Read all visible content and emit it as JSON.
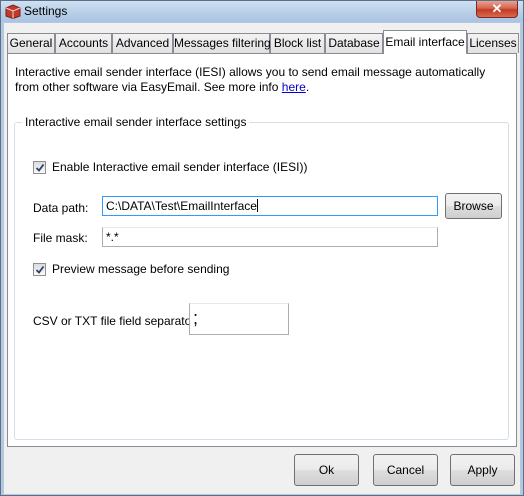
{
  "window": {
    "title": "Settings",
    "close_symbol": "✕",
    "icon": "settings-app-icon"
  },
  "tabs": [
    {
      "label": "General"
    },
    {
      "label": "Accounts"
    },
    {
      "label": "Advanced"
    },
    {
      "label": "Messages filtering"
    },
    {
      "label": "Block list"
    },
    {
      "label": "Database"
    },
    {
      "label": "Email interface",
      "active": true
    },
    {
      "label": "Licenses"
    }
  ],
  "intro": {
    "text": "Interactive email sender interface (IESI) allows you to send email message automatically from other software via EasyEmail. See more info ",
    "link": "here",
    "after": "."
  },
  "group": {
    "legend": "Interactive email sender interface settings"
  },
  "enable_iesi": {
    "label": "Enable Interactive email sender interface (IESI))",
    "checked": true
  },
  "data_path": {
    "label": "Data path:",
    "value": "C:\\DATA\\Test\\EmailInterface"
  },
  "browse_label": "Browse",
  "file_mask": {
    "label": "File mask:",
    "value": "*.*"
  },
  "preview": {
    "label": "Preview message before sending",
    "checked": true
  },
  "separator": {
    "label": "CSV or TXT file field separator:",
    "value": ";"
  },
  "footer": {
    "ok": "Ok",
    "cancel": "Cancel",
    "apply": "Apply"
  },
  "colors": {
    "title_bar": "#b9cfe8",
    "close_button": "#c23a22",
    "link": "#0000cc",
    "focus_border": "#3399ff"
  }
}
